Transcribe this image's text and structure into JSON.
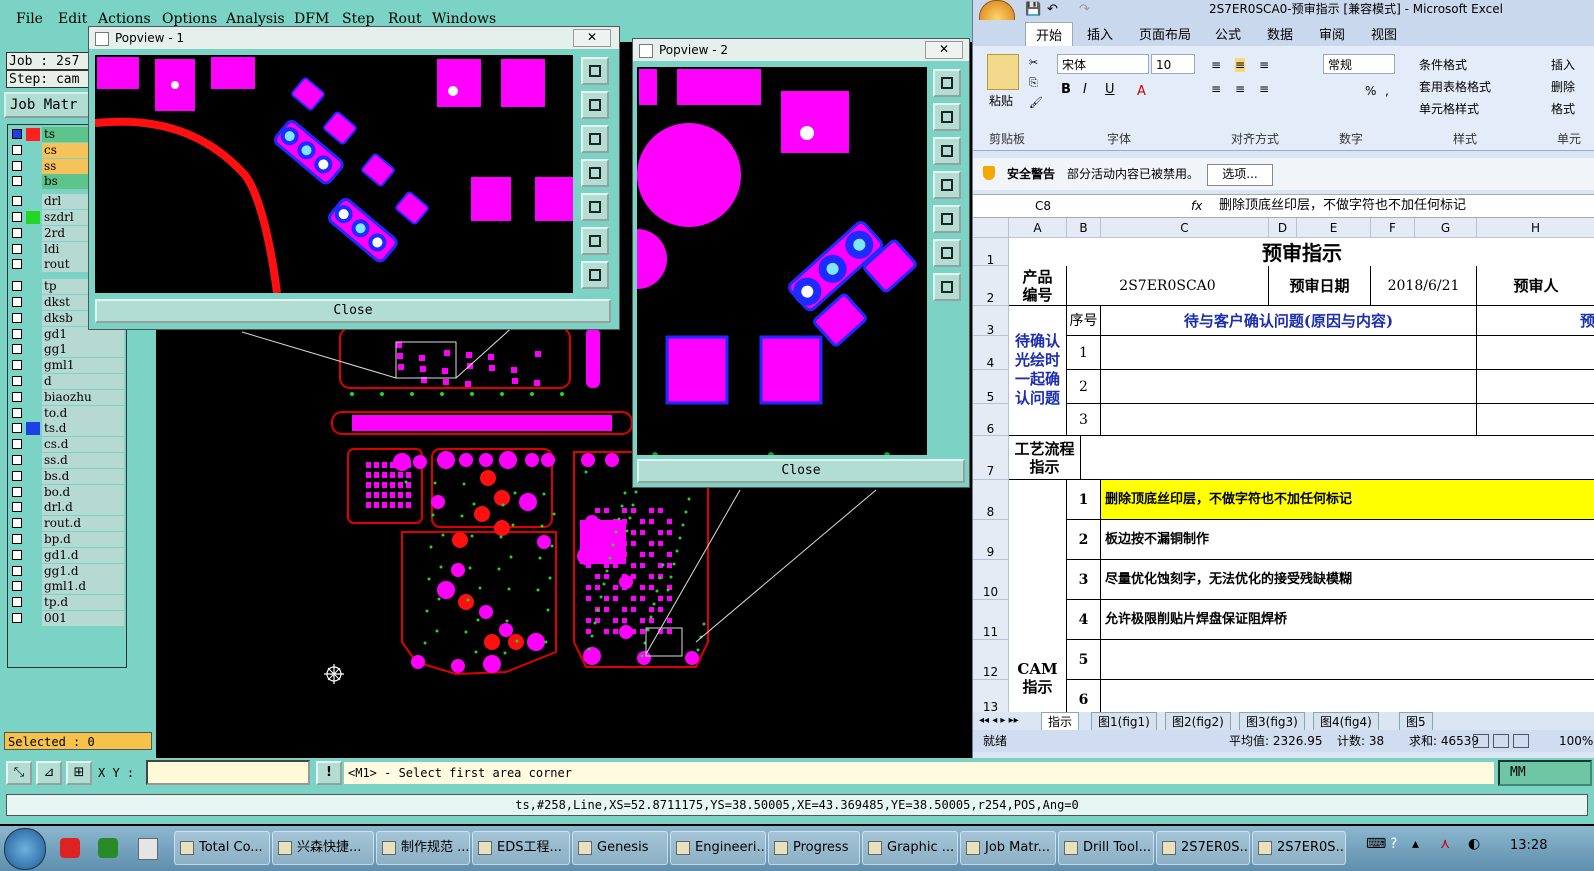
{
  "genesis": {
    "menu": [
      "File",
      "Edit",
      "Actions",
      "Options",
      "Analysis",
      "DFM",
      "Step",
      "Rout",
      "Windows"
    ],
    "job_label": "Job : 2s7",
    "step_label": "Step: cam",
    "job_matrix_button": "Job Matr",
    "layers": [
      {
        "name": "ts",
        "color": "#ff2020",
        "name_bg": "#5dc48b",
        "active": true
      },
      {
        "name": "cs",
        "color": "",
        "name_bg": "#f6c35a"
      },
      {
        "name": "ss",
        "color": "",
        "name_bg": "#f6c35a"
      },
      {
        "name": "bs",
        "color": "",
        "name_bg": "#5dc48b"
      },
      {
        "name": "drl",
        "color": "",
        "name_bg": "#b6d9d2"
      },
      {
        "name": "szdrl",
        "color": "#23d623",
        "name_bg": "#b6d9d2"
      },
      {
        "name": "2rd",
        "color": "",
        "name_bg": "#b6d9d2"
      },
      {
        "name": "ldi",
        "color": "",
        "name_bg": "#b6d9d2"
      },
      {
        "name": "rout",
        "color": "",
        "name_bg": "#b6d9d2"
      },
      {
        "name": "tp",
        "color": "",
        "name_bg": "#b6d9d2"
      },
      {
        "name": "dkst",
        "color": "",
        "name_bg": "#b6d9d2"
      },
      {
        "name": "dksb",
        "color": "",
        "name_bg": "#b6d9d2"
      },
      {
        "name": "gd1",
        "color": "",
        "name_bg": "#b6d9d2"
      },
      {
        "name": "gg1",
        "color": "",
        "name_bg": "#b6d9d2"
      },
      {
        "name": "gml1",
        "color": "",
        "name_bg": "#b6d9d2"
      },
      {
        "name": "d",
        "color": "",
        "name_bg": "#b6d9d2"
      },
      {
        "name": "biaozhu",
        "color": "",
        "name_bg": "#b6d9d2"
      },
      {
        "name": "to.d",
        "color": "",
        "name_bg": "#b6d9d2"
      },
      {
        "name": "ts.d",
        "color": "#1d3fe6",
        "name_bg": "#b6d9d2"
      },
      {
        "name": "cs.d",
        "color": "",
        "name_bg": "#b6d9d2"
      },
      {
        "name": "ss.d",
        "color": "",
        "name_bg": "#b6d9d2"
      },
      {
        "name": "bs.d",
        "color": "",
        "name_bg": "#b6d9d2"
      },
      {
        "name": "bo.d",
        "color": "",
        "name_bg": "#b6d9d2"
      },
      {
        "name": "drl.d",
        "color": "",
        "name_bg": "#b6d9d2"
      },
      {
        "name": "rout.d",
        "color": "",
        "name_bg": "#b6d9d2"
      },
      {
        "name": "bp.d",
        "color": "",
        "name_bg": "#b6d9d2"
      },
      {
        "name": "gd1.d",
        "color": "",
        "name_bg": "#b6d9d2"
      },
      {
        "name": "gg1.d",
        "color": "",
        "name_bg": "#b6d9d2"
      },
      {
        "name": "gml1.d",
        "color": "",
        "name_bg": "#b6d9d2"
      },
      {
        "name": "tp.d",
        "color": "",
        "name_bg": "#b6d9d2"
      },
      {
        "name": "001",
        "color": "",
        "name_bg": "#b6d9d2"
      }
    ],
    "selected_label": "Selected : 0",
    "xy_label": "X Y :",
    "prompt": "<M1> - Select first area corner",
    "units": "MM",
    "status_line": "ts,#258,Line,XS=52.8711175,YS=38.50005,XE=43.369485,YE=38.50005,r254,POS,Ang=0",
    "colors": {
      "pad": "#ff00ff",
      "trace": "#ff1010",
      "outline": "#e00000",
      "bg": "#000000",
      "panel": "#7ad3c4",
      "mask": "#1c2bff"
    }
  },
  "popview1": {
    "title": "Popview - 1",
    "close_label": "Close"
  },
  "popview2": {
    "title": "Popview - 2",
    "close_label": "Close"
  },
  "excel": {
    "title": "2S7ER0SCA0-预审指示  [兼容模式] - Microsoft Excel",
    "tabs": [
      "开始",
      "插入",
      "页面布局",
      "公式",
      "数据",
      "审阅",
      "视图"
    ],
    "ribbon": {
      "paste": "粘贴",
      "font_name": "宋体",
      "font_size": "10",
      "number_format": "常规",
      "cond_format": "条件格式",
      "table_format": "套用表格格式",
      "cell_style": "单元格样式",
      "insert": "插入",
      "delete": "删除",
      "format": "格式",
      "groups": [
        "剪贴板",
        "字体",
        "对齐方式",
        "数字",
        "样式",
        "单元"
      ]
    },
    "warning": {
      "title": "安全警告",
      "text": "部分活动内容已被禁用。",
      "button": "选项..."
    },
    "name_box": "C8",
    "formula": "删除顶底丝印层，不做字符也不加任何标记",
    "columns": [
      "A",
      "B",
      "C",
      "D",
      "E",
      "F",
      "G",
      "H"
    ],
    "rows": [
      "1",
      "2",
      "3",
      "4",
      "5",
      "6",
      "7",
      "8",
      "9",
      "10",
      "11",
      "12",
      "13"
    ],
    "sheet": {
      "title": "预审指示",
      "product_label": "产品\n编号",
      "product_value": "2S7ER0SCA0",
      "date_label": "预审日期",
      "date_value": "2018/6/21",
      "reviewer_label": "预审人",
      "pending_label": "待确认\n光绘时\n一起确\n认问题",
      "seq_header": "序号",
      "issue_header": "待与客户确认问题(原因与内容)",
      "cut_header": "预",
      "pending_rows": [
        "1",
        "2",
        "3"
      ],
      "process_label": "工艺流程\n指示",
      "cam_label": "CAM\n指示",
      "instructions": [
        {
          "n": "1",
          "text": "删除顶底丝印层，不做字符也不加任何标记"
        },
        {
          "n": "2",
          "text": "板边按不漏铜制作"
        },
        {
          "n": "3",
          "text": "尽量优化蚀刻字，无法优化的接受残缺模糊"
        },
        {
          "n": "4",
          "text": "允许极限削贴片焊盘保证阻焊桥"
        },
        {
          "n": "5",
          "text": ""
        },
        {
          "n": "6",
          "text": ""
        }
      ]
    },
    "sheet_tabs": [
      "指示",
      "图1(fig1)",
      "图2(fig2)",
      "图3(fig3)",
      "图4(fig4)",
      "图5"
    ],
    "status": {
      "ready": "就绪",
      "avg": "平均值: 2326.95",
      "count": "计数: 38",
      "sum": "求和: 46539",
      "zoom": "100%"
    }
  },
  "taskbar": {
    "items": [
      "Total Co...",
      "兴森快捷...",
      "制作规范 ...",
      "EDS工程...",
      "Genesis",
      "Engineeri...",
      "Progress",
      "Graphic ...",
      "Job Matr...",
      "Drill Tool...",
      "2S7ER0S...",
      "2S7ER0S..."
    ],
    "clock": "13:28"
  }
}
